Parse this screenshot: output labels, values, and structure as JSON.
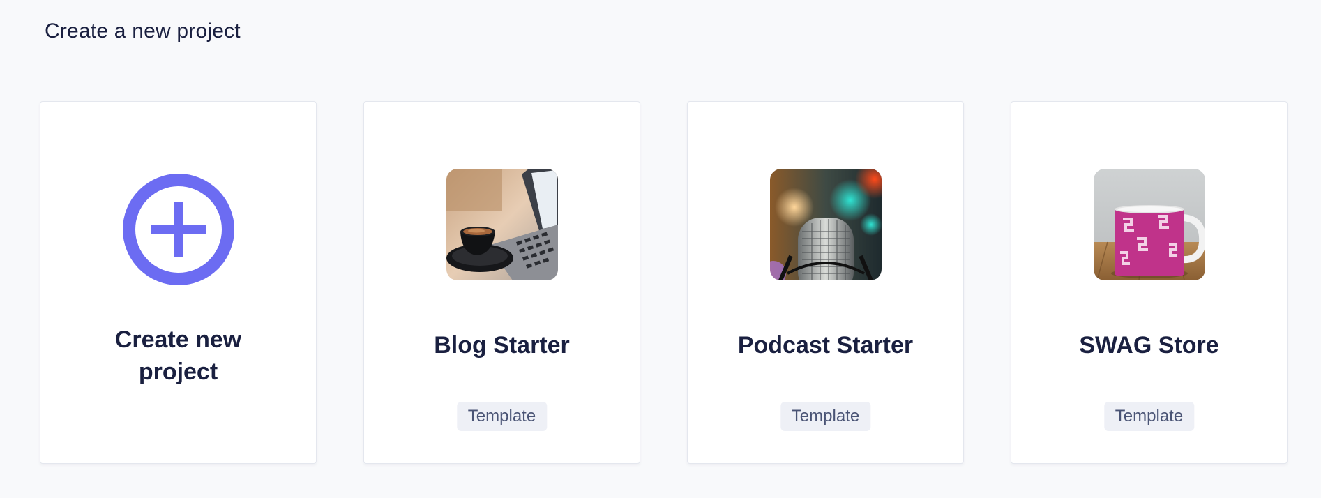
{
  "page": {
    "title": "Create a new project"
  },
  "create_card": {
    "label": "Create new project",
    "icon": "plus-circle-icon",
    "icon_color": "#6c6cf2"
  },
  "templates": [
    {
      "title": "Blog Starter",
      "badge": "Template",
      "thumbnail": "coffee-laptop-photo"
    },
    {
      "title": "Podcast Starter",
      "badge": "Template",
      "thumbnail": "microphone-photo"
    },
    {
      "title": "SWAG Store",
      "badge": "Template",
      "thumbnail": "pink-mug-photo"
    }
  ],
  "colors": {
    "background": "#f8f9fb",
    "card": "#ffffff",
    "text": "#1a2040",
    "badge_bg": "#eef0f6",
    "badge_text": "#4a5475"
  }
}
